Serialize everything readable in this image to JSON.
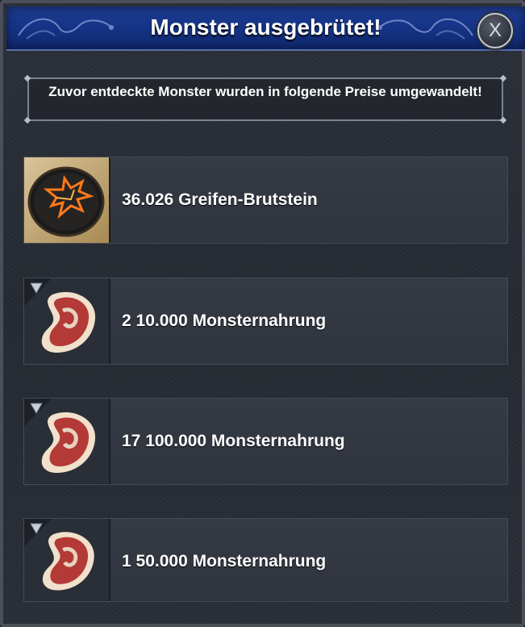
{
  "dialog": {
    "title": "Monster ausgebrütet!",
    "close_label": "X",
    "notice": "Zuvor entdeckte Monster wurden in folgende Preise umgewandelt!"
  },
  "rewards": [
    {
      "label": "36.026 Greifen-Brutstein",
      "icon": "griffin-hatchstone-icon"
    },
    {
      "label": "2 10.000 Monsternahrung",
      "icon": "meat-icon"
    },
    {
      "label": "17 100.000 Monsternahrung",
      "icon": "meat-icon"
    },
    {
      "label": "1 50.000 Monsternahrung",
      "icon": "meat-icon"
    }
  ],
  "colors": {
    "header": "#16358a",
    "panel": "#2a2e37",
    "accent": "#ff7a1a"
  }
}
